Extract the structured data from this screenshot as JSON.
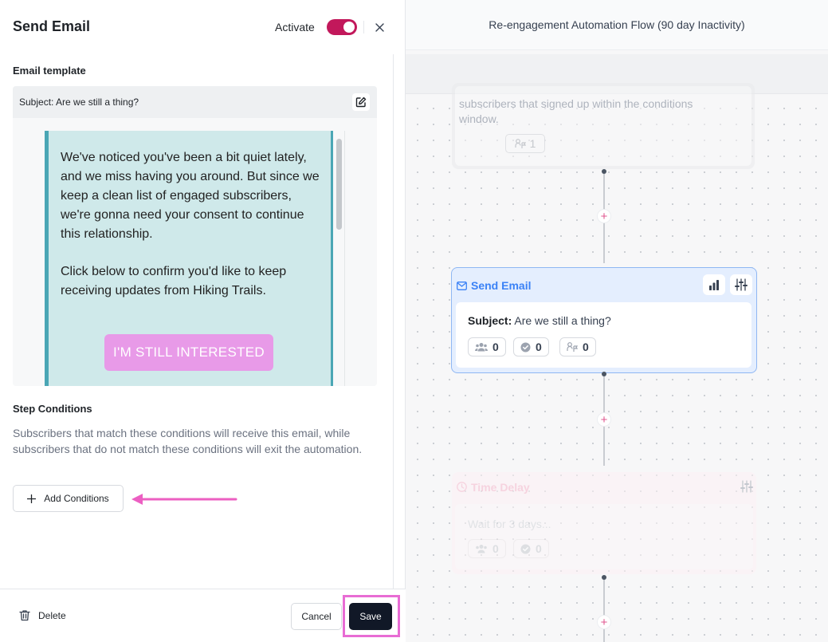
{
  "panel": {
    "title": "Send Email",
    "activate_label": "Activate",
    "activate_on": true
  },
  "template": {
    "section_label": "Email template",
    "subject": "Subject: Are we still a thing?",
    "body_paragraph_1": "We've noticed you've been a bit quiet lately, and we miss having you around. But since we keep a clean list of engaged subscribers, we're gonna need your consent to continue this relationship.",
    "body_paragraph_2": "Click below to confirm you'd like to keep receiving updates from Hiking Trails.",
    "cta_label": "I'M STILL INTERESTED"
  },
  "conditions": {
    "section_label": "Step Conditions",
    "description": "Subscribers that match these conditions will receive this email, while subscribers that do not match these conditions will exit the automation.",
    "add_button_label": "Add Conditions"
  },
  "footer": {
    "delete_label": "Delete",
    "cancel_label": "Cancel",
    "save_label": "Save"
  },
  "canvas": {
    "flow_title": "Re-engagement Automation Flow (90 day Inactivity)",
    "previous_node": {
      "text": "subscribers that signed up within the conditions window.",
      "stat_count": "1"
    },
    "send_email_node": {
      "title": "Send Email",
      "subject_label": "Subject:",
      "subject_value": "Are we still a thing?",
      "stats": [
        "0",
        "0",
        "0"
      ]
    },
    "time_delay_node": {
      "title": "Time Delay",
      "text": "Wait for 3 days...",
      "stats": [
        "0",
        "0"
      ]
    }
  },
  "colors": {
    "toggle_on": "#c2185b",
    "highlight": "#e86cd4",
    "node_accent": "#3b82f6",
    "email_bg": "#cfe9ea",
    "email_border": "#4aa6b5",
    "cta_bg": "#e89ae8"
  }
}
